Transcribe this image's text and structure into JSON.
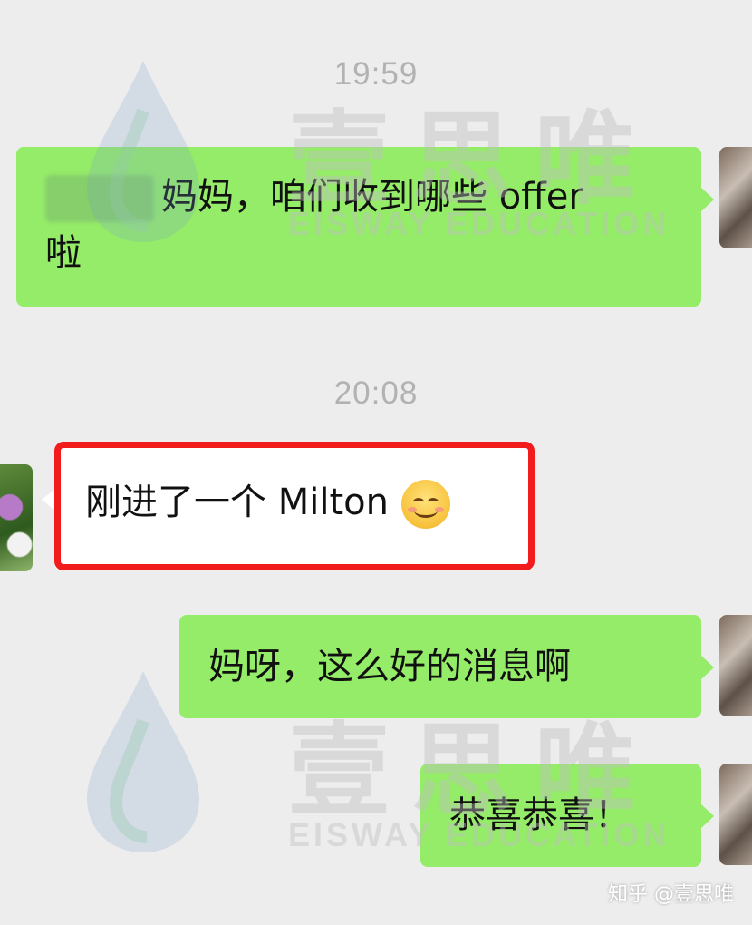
{
  "messages": [
    {
      "time": "19:59"
    },
    {
      "text_line1": "妈妈，咱们收到哪些 offer",
      "text_line2": "啦"
    },
    {
      "time": "20:08"
    },
    {
      "text": "刚进了一个 Milton"
    },
    {
      "text": "妈呀，这么好的消息啊"
    },
    {
      "text": "恭喜恭喜！"
    }
  ],
  "watermark": {
    "cn": "壹思唯",
    "en": "EISWAY EDUCATION"
  },
  "footer": {
    "source": "知乎 @壹思唯"
  },
  "icons": [
    "smiling-emoji-icon",
    "eisway-logo-icon"
  ],
  "colors": {
    "bubble_sent": "#95ec69",
    "bubble_received": "#ffffff",
    "highlight": "#f21c1c",
    "background": "#ededed"
  }
}
